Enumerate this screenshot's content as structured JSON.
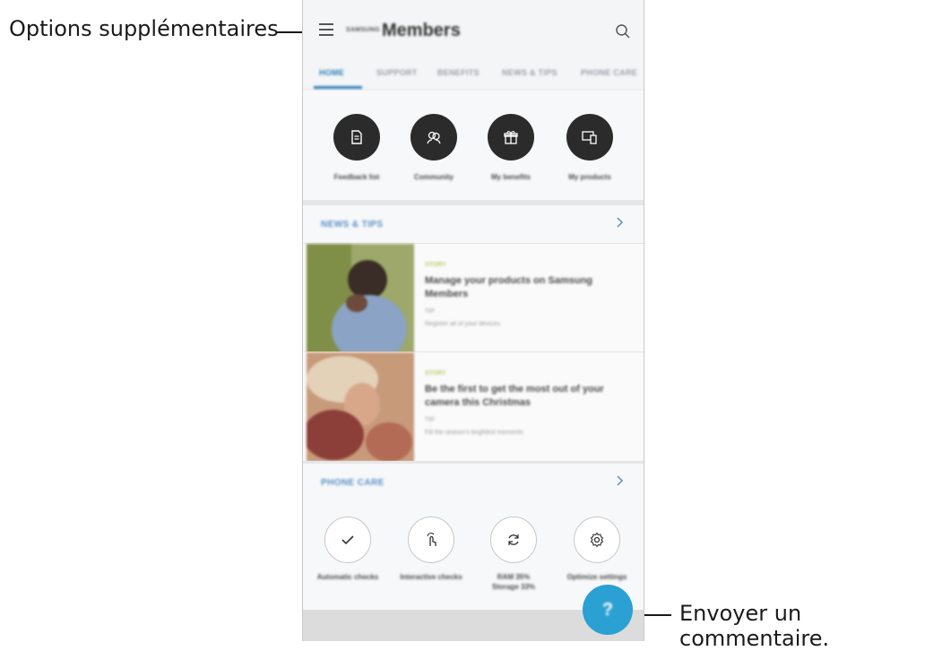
{
  "callouts": {
    "more_options": "Options supplémentaires",
    "send_feedback": "Envoyer un commentaire."
  },
  "app": {
    "brand_prefix": "SAMSUNG",
    "brand": "Members",
    "tabs": [
      "HOME",
      "SUPPORT",
      "BENEFITS",
      "NEWS & TIPS",
      "PHONE CARE"
    ],
    "active_tab": "HOME"
  },
  "quick_actions": [
    {
      "label": "Feedback list",
      "icon": "document-icon"
    },
    {
      "label": "Community",
      "icon": "people-icon"
    },
    {
      "label": "My benefits",
      "icon": "gift-icon"
    },
    {
      "label": "My products",
      "icon": "devices-icon"
    }
  ],
  "news": {
    "title": "NEWS & TIPS",
    "items": [
      {
        "category": "STORY",
        "title": "Manage your products on Samsung Members",
        "meta": "TIP",
        "sub": "Register all of your devices"
      },
      {
        "category": "STORY",
        "title": "Be the first to get the most out of your camera this Christmas",
        "meta": "TIP",
        "sub": "Fill the season's brightest moments"
      }
    ]
  },
  "phone_care": {
    "title": "PHONE CARE",
    "items": [
      {
        "label": "Automatic checks",
        "icon": "check-icon"
      },
      {
        "label": "Interactive checks",
        "icon": "touch-icon"
      },
      {
        "label": "RAM 35%\nStorage 33%",
        "line1": "RAM 35%",
        "line2": "Storage 33%",
        "icon": "refresh-icon"
      },
      {
        "label": "Optimize settings",
        "icon": "settings-icon"
      }
    ]
  },
  "fab": {
    "label": "?"
  },
  "colors": {
    "accent": "#2c7fb8",
    "fab": "#2aa0d3",
    "dark_circle": "#2b2b2b"
  }
}
